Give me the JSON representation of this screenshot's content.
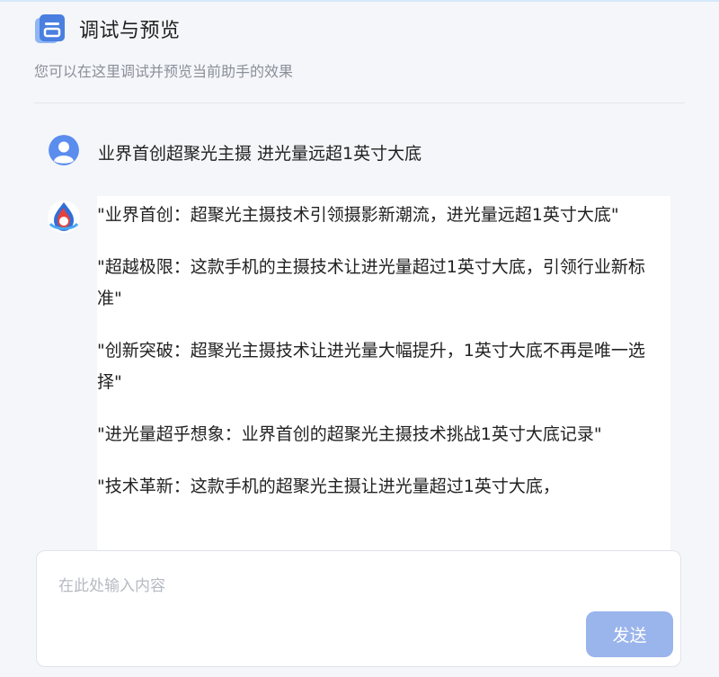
{
  "header": {
    "title": "调试与预览",
    "subtitle": "您可以在这里调试并预览当前助手的效果",
    "icon": "document-preview-icon"
  },
  "conversation": {
    "user_message": "业界首创超聚光主摄 进光量远超1英寸大底",
    "bot_paragraphs": [
      "\"业界首创：超聚光主摄技术引领摄影新潮流，进光量远超1英寸大底\"",
      "\"超越极限：这款手机的主摄技术让进光量超过1英寸大底，引领行业新标准\"",
      "\"创新突破：超聚光主摄技术让进光量大幅提升，1英寸大底不再是唯一选择\"",
      "\"进光量超乎想象：业界首创的超聚光主摄技术挑战1英寸大底记录\"",
      "\"技术革新：这款手机的超聚光主摄让进光量超过1英寸大底，"
    ]
  },
  "composer": {
    "placeholder": "在此处输入内容",
    "value": "",
    "send_label": "发送"
  },
  "colors": {
    "accent": "#4a7fe0",
    "send_button": "#9ab4ec",
    "background": "#f5f6fa"
  }
}
